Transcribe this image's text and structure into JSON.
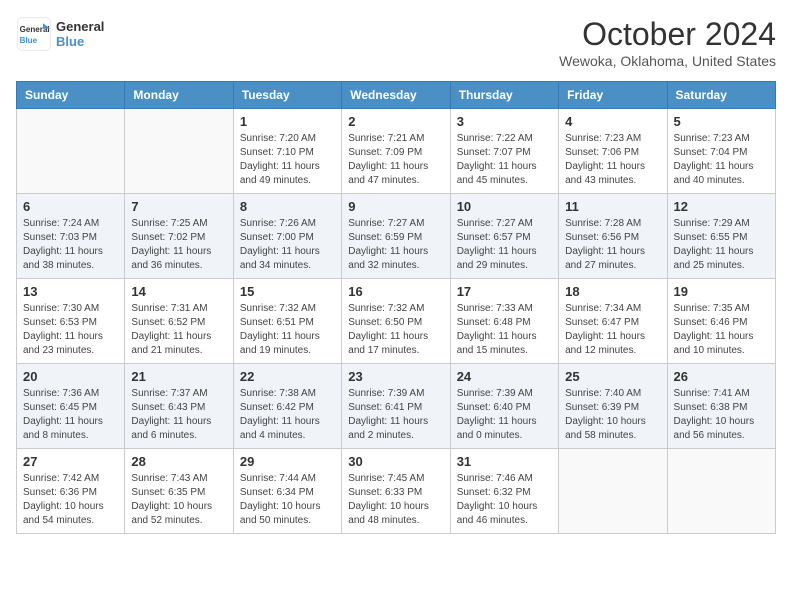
{
  "header": {
    "logo_general": "General",
    "logo_blue": "Blue",
    "month_title": "October 2024",
    "location": "Wewoka, Oklahoma, United States"
  },
  "days_of_week": [
    "Sunday",
    "Monday",
    "Tuesday",
    "Wednesday",
    "Thursday",
    "Friday",
    "Saturday"
  ],
  "weeks": [
    [
      {
        "day": "",
        "info": ""
      },
      {
        "day": "",
        "info": ""
      },
      {
        "day": "1",
        "info": "Sunrise: 7:20 AM\nSunset: 7:10 PM\nDaylight: 11 hours and 49 minutes."
      },
      {
        "day": "2",
        "info": "Sunrise: 7:21 AM\nSunset: 7:09 PM\nDaylight: 11 hours and 47 minutes."
      },
      {
        "day": "3",
        "info": "Sunrise: 7:22 AM\nSunset: 7:07 PM\nDaylight: 11 hours and 45 minutes."
      },
      {
        "day": "4",
        "info": "Sunrise: 7:23 AM\nSunset: 7:06 PM\nDaylight: 11 hours and 43 minutes."
      },
      {
        "day": "5",
        "info": "Sunrise: 7:23 AM\nSunset: 7:04 PM\nDaylight: 11 hours and 40 minutes."
      }
    ],
    [
      {
        "day": "6",
        "info": "Sunrise: 7:24 AM\nSunset: 7:03 PM\nDaylight: 11 hours and 38 minutes."
      },
      {
        "day": "7",
        "info": "Sunrise: 7:25 AM\nSunset: 7:02 PM\nDaylight: 11 hours and 36 minutes."
      },
      {
        "day": "8",
        "info": "Sunrise: 7:26 AM\nSunset: 7:00 PM\nDaylight: 11 hours and 34 minutes."
      },
      {
        "day": "9",
        "info": "Sunrise: 7:27 AM\nSunset: 6:59 PM\nDaylight: 11 hours and 32 minutes."
      },
      {
        "day": "10",
        "info": "Sunrise: 7:27 AM\nSunset: 6:57 PM\nDaylight: 11 hours and 29 minutes."
      },
      {
        "day": "11",
        "info": "Sunrise: 7:28 AM\nSunset: 6:56 PM\nDaylight: 11 hours and 27 minutes."
      },
      {
        "day": "12",
        "info": "Sunrise: 7:29 AM\nSunset: 6:55 PM\nDaylight: 11 hours and 25 minutes."
      }
    ],
    [
      {
        "day": "13",
        "info": "Sunrise: 7:30 AM\nSunset: 6:53 PM\nDaylight: 11 hours and 23 minutes."
      },
      {
        "day": "14",
        "info": "Sunrise: 7:31 AM\nSunset: 6:52 PM\nDaylight: 11 hours and 21 minutes."
      },
      {
        "day": "15",
        "info": "Sunrise: 7:32 AM\nSunset: 6:51 PM\nDaylight: 11 hours and 19 minutes."
      },
      {
        "day": "16",
        "info": "Sunrise: 7:32 AM\nSunset: 6:50 PM\nDaylight: 11 hours and 17 minutes."
      },
      {
        "day": "17",
        "info": "Sunrise: 7:33 AM\nSunset: 6:48 PM\nDaylight: 11 hours and 15 minutes."
      },
      {
        "day": "18",
        "info": "Sunrise: 7:34 AM\nSunset: 6:47 PM\nDaylight: 11 hours and 12 minutes."
      },
      {
        "day": "19",
        "info": "Sunrise: 7:35 AM\nSunset: 6:46 PM\nDaylight: 11 hours and 10 minutes."
      }
    ],
    [
      {
        "day": "20",
        "info": "Sunrise: 7:36 AM\nSunset: 6:45 PM\nDaylight: 11 hours and 8 minutes."
      },
      {
        "day": "21",
        "info": "Sunrise: 7:37 AM\nSunset: 6:43 PM\nDaylight: 11 hours and 6 minutes."
      },
      {
        "day": "22",
        "info": "Sunrise: 7:38 AM\nSunset: 6:42 PM\nDaylight: 11 hours and 4 minutes."
      },
      {
        "day": "23",
        "info": "Sunrise: 7:39 AM\nSunset: 6:41 PM\nDaylight: 11 hours and 2 minutes."
      },
      {
        "day": "24",
        "info": "Sunrise: 7:39 AM\nSunset: 6:40 PM\nDaylight: 11 hours and 0 minutes."
      },
      {
        "day": "25",
        "info": "Sunrise: 7:40 AM\nSunset: 6:39 PM\nDaylight: 10 hours and 58 minutes."
      },
      {
        "day": "26",
        "info": "Sunrise: 7:41 AM\nSunset: 6:38 PM\nDaylight: 10 hours and 56 minutes."
      }
    ],
    [
      {
        "day": "27",
        "info": "Sunrise: 7:42 AM\nSunset: 6:36 PM\nDaylight: 10 hours and 54 minutes."
      },
      {
        "day": "28",
        "info": "Sunrise: 7:43 AM\nSunset: 6:35 PM\nDaylight: 10 hours and 52 minutes."
      },
      {
        "day": "29",
        "info": "Sunrise: 7:44 AM\nSunset: 6:34 PM\nDaylight: 10 hours and 50 minutes."
      },
      {
        "day": "30",
        "info": "Sunrise: 7:45 AM\nSunset: 6:33 PM\nDaylight: 10 hours and 48 minutes."
      },
      {
        "day": "31",
        "info": "Sunrise: 7:46 AM\nSunset: 6:32 PM\nDaylight: 10 hours and 46 minutes."
      },
      {
        "day": "",
        "info": ""
      },
      {
        "day": "",
        "info": ""
      }
    ]
  ]
}
